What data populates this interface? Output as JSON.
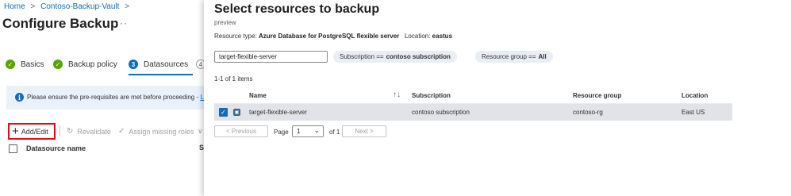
{
  "breadcrumb": {
    "home": "Home",
    "vault": "Contoso-Backup-Vault",
    "sep": ">"
  },
  "page": {
    "title": "Configure Backup",
    "more": "···"
  },
  "steps": [
    {
      "num": "✓",
      "label": "Basics",
      "state": "done"
    },
    {
      "num": "✓",
      "label": "Backup policy",
      "state": "done"
    },
    {
      "num": "3",
      "label": "Datasources",
      "state": "current"
    },
    {
      "num": "4",
      "label": "",
      "state": "next"
    }
  ],
  "info": {
    "icon": "i",
    "text": "Please ensure the pre-requisites are met before proceeding - ",
    "link": "Le"
  },
  "commands": {
    "add_edit": "Add/Edit",
    "revalidate": "Revalidate",
    "assign_roles": "Assign missing roles",
    "more": "∨"
  },
  "datasource_list": {
    "col_name": "Datasource name",
    "col_extra": "Sr"
  },
  "panel": {
    "title": "Select resources to backup",
    "subtitle": "preview",
    "resource_type_label": "Resource type: ",
    "resource_type": "Azure Database for PostgreSQL flexible server",
    "location_label": "Location: ",
    "location": "eastus"
  },
  "filters": {
    "search_value": "target-flexible-server",
    "subscription_label": "Subscription ==",
    "subscription_value": "contoso subscription",
    "rg_label": "Resource group ==",
    "rg_value": "All"
  },
  "results": {
    "count": "1-1 of 1 items"
  },
  "table": {
    "columns": [
      "Name",
      "Subscription",
      "Resource group",
      "Location"
    ],
    "sort_icon": "↑↓",
    "rows": [
      {
        "selected": true,
        "name": "target-flexible-server",
        "subscription": "contoso subscription",
        "resource_group": "contoso-rg",
        "location": "East US"
      }
    ]
  },
  "pager": {
    "prev": "< Previous",
    "page_label": "Page",
    "page_value": "1",
    "of_label": "of 1",
    "next": "Next >"
  },
  "colors": {
    "accent": "#0f6cbd",
    "success": "#57a300",
    "highlight_box": "#e00b1c",
    "selected_row": "#e1e3e8"
  }
}
